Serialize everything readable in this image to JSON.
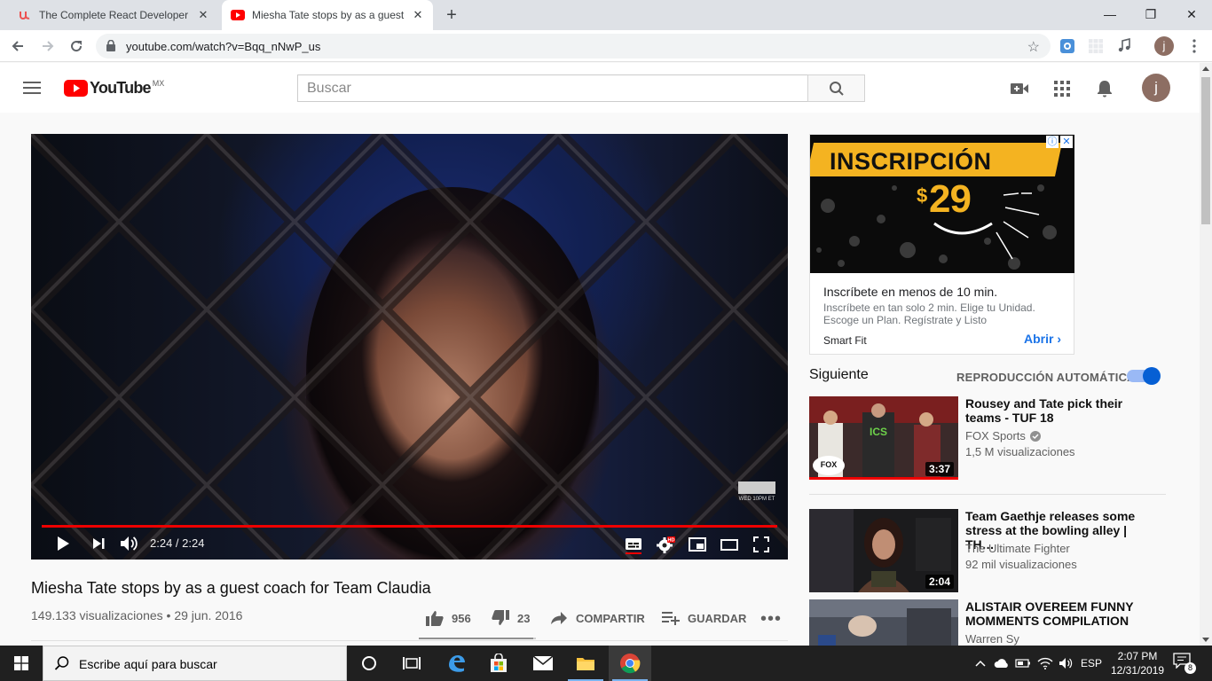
{
  "browser": {
    "tabs": [
      {
        "title": "The Complete React Developer C",
        "favicon": "udemy-icon"
      },
      {
        "title": "Miesha Tate stops by as a guest c",
        "favicon": "youtube-icon"
      }
    ],
    "url": "youtube.com/watch?v=Bqq_nNwP_us",
    "profile_initial": "j",
    "window_controls": {
      "minimize": "—",
      "maximize": "❐",
      "close": "✕"
    }
  },
  "youtube": {
    "logo_text": "YouTube",
    "country_code": "MX",
    "search_placeholder": "Buscar",
    "avatar_initial": "j"
  },
  "player": {
    "time_display": "2:24 / 2:24",
    "progress": 1.0,
    "watermark": "WED 10PM ET"
  },
  "video": {
    "title": "Miesha Tate stops by as a guest coach for Team Claudia",
    "meta": "149.133 visualizaciones • 29 jun. 2016",
    "likes": "956",
    "dislikes": "23",
    "share_label": "COMPARTIR",
    "save_label": "GUARDAR",
    "like_ratio": 0.976
  },
  "ad": {
    "banner_headline": "INSCRIPCIÓN",
    "price_currency": "$",
    "price_amount": "29",
    "headline": "Inscríbete en menos de 10 min.",
    "description": "Inscríbete en tan solo 2 min. Elige tu Unidad. Escoge un Plan. Regístrate y Listo",
    "advertiser": "Smart Fit",
    "cta": "Abrir"
  },
  "upnext": {
    "label": "Siguiente",
    "autoplay_label": "REPRODUCCIÓN AUTOMÁTICA",
    "autoplay_on": true,
    "items": [
      {
        "title": "Rousey and Tate pick their teams - TUF 18",
        "channel": "FOX Sports",
        "verified": true,
        "views": "1,5 M visualizaciones",
        "duration": "3:37",
        "watched": true
      },
      {
        "title": "Team Gaethje releases some stress at the bowling alley | TH…",
        "channel": "The Ultimate Fighter",
        "verified": false,
        "views": "92 mil visualizaciones",
        "duration": "2:04",
        "watched": false
      },
      {
        "title": "ALISTAIR OVEREEM FUNNY MOMMENTS COMPILATION",
        "channel": "Warren Sy",
        "verified": false,
        "views": "",
        "duration": "",
        "watched": false
      }
    ]
  },
  "taskbar": {
    "search_text": "Escribe aquí para buscar",
    "language": "ESP",
    "time": "2:07 PM",
    "date": "12/31/2019",
    "notification_count": "8"
  },
  "colors": {
    "youtube_red": "#ff0000",
    "progress_red": "#ee0000",
    "link_blue": "#1a73e8",
    "toggle_blue": "#065fd4",
    "ad_yellow": "#f4b321"
  }
}
